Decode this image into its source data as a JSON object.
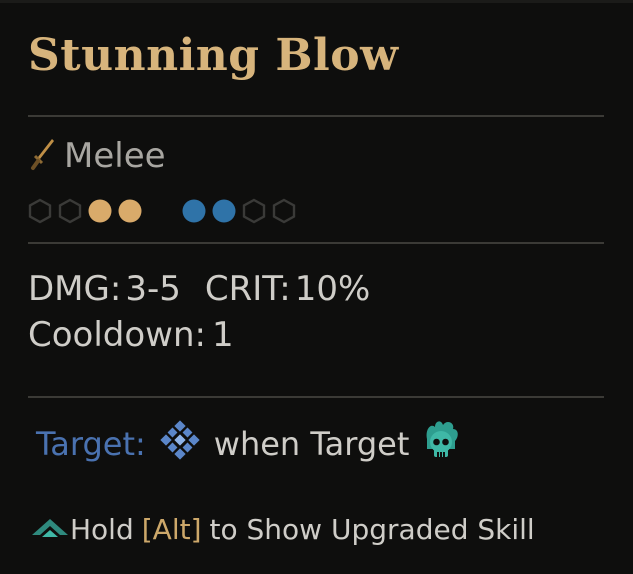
{
  "tooltip": {
    "title": "Stunning Blow",
    "skill_type": {
      "label": "Melee",
      "icon": "dagger-icon"
    },
    "ranks": [
      {
        "kind": "position-hex",
        "state": "empty"
      },
      {
        "kind": "position-hex",
        "state": "empty"
      },
      {
        "kind": "position-dot",
        "state": "launch",
        "color": "#d9aa6a"
      },
      {
        "kind": "position-dot",
        "state": "launch",
        "color": "#d9aa6a"
      },
      {
        "kind": "target-dot",
        "state": "target",
        "color": "#2f73a8"
      },
      {
        "kind": "target-dot",
        "state": "target",
        "color": "#2f73a8"
      },
      {
        "kind": "target-hex",
        "state": "empty"
      },
      {
        "kind": "target-hex",
        "state": "empty"
      }
    ],
    "stats": {
      "dmg_label": "DMG:",
      "dmg_value": "3-5",
      "crit_label": "CRIT:",
      "crit_value": "10%",
      "cooldown_label": "Cooldown:",
      "cooldown_value": "1"
    },
    "effect": {
      "target_label": "Target:",
      "stun_icon": "stun-icon",
      "when_text": "when Target",
      "condition_icon": "flaming-skull-icon"
    },
    "hint": {
      "icon": "upgrade-chevron-icon",
      "prefix": "Hold",
      "key": "[Alt]",
      "suffix": "to Show Upgraded Skill"
    },
    "colors": {
      "title": "#d7b47c",
      "launch_rank": "#d9aa6a",
      "target_rank": "#2f73a8",
      "target_label": "#4a72b0",
      "hint_key": "#cda86a",
      "stun_icon": "#5b86c9",
      "condition_icon": "#3fb8a6"
    }
  }
}
